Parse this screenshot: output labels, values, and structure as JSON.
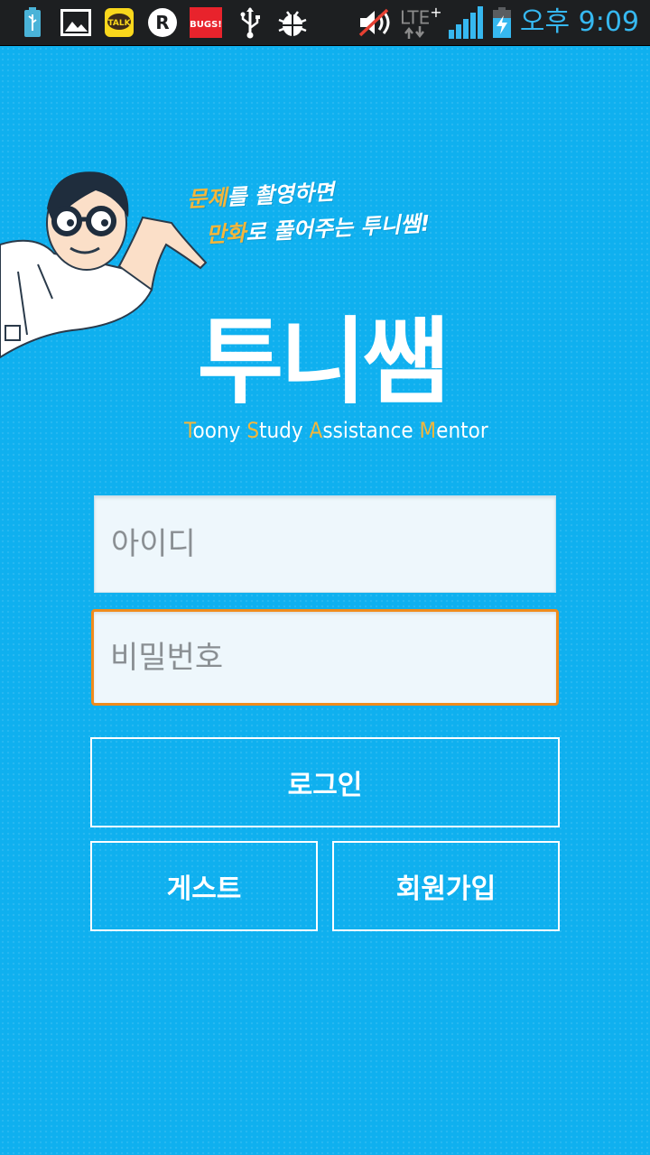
{
  "status_bar": {
    "time": "오후 9:09",
    "network": "LTE",
    "network_plus": "+",
    "icons": [
      "usb-battery-icon",
      "gallery-icon",
      "kakaotalk-icon",
      "r-app-icon",
      "bugs-icon",
      "usb-icon",
      "android-debug-icon",
      "mute-icon",
      "lte-icon",
      "signal-icon",
      "battery-charging-icon"
    ],
    "kakao_label": "TALK",
    "r_label": "R",
    "bugs_label": "BUGS!"
  },
  "intro": {
    "tagline_line1_hl": "문제",
    "tagline_line1_rest": "를 촬영하면",
    "tagline_line2_hl": "만화",
    "tagline_line2_rest": "로 풀어주는 투니쌤!"
  },
  "logo": {
    "title": "투니쌤",
    "sub_T": "T",
    "sub_T_rest": "oony ",
    "sub_S": "S",
    "sub_S_rest": "tudy ",
    "sub_A": "A",
    "sub_A_rest": "ssistance ",
    "sub_M": "M",
    "sub_M_rest": "entor"
  },
  "form": {
    "id_placeholder": "아이디",
    "password_placeholder": "비밀번호",
    "login_label": "로그인",
    "guest_label": "게스트",
    "signup_label": "회원가입"
  },
  "colors": {
    "background": "#0fb0ef",
    "accent_orange": "#f08c1c",
    "highlight_yellow": "#f5b63a",
    "status_time": "#36b8f0"
  }
}
